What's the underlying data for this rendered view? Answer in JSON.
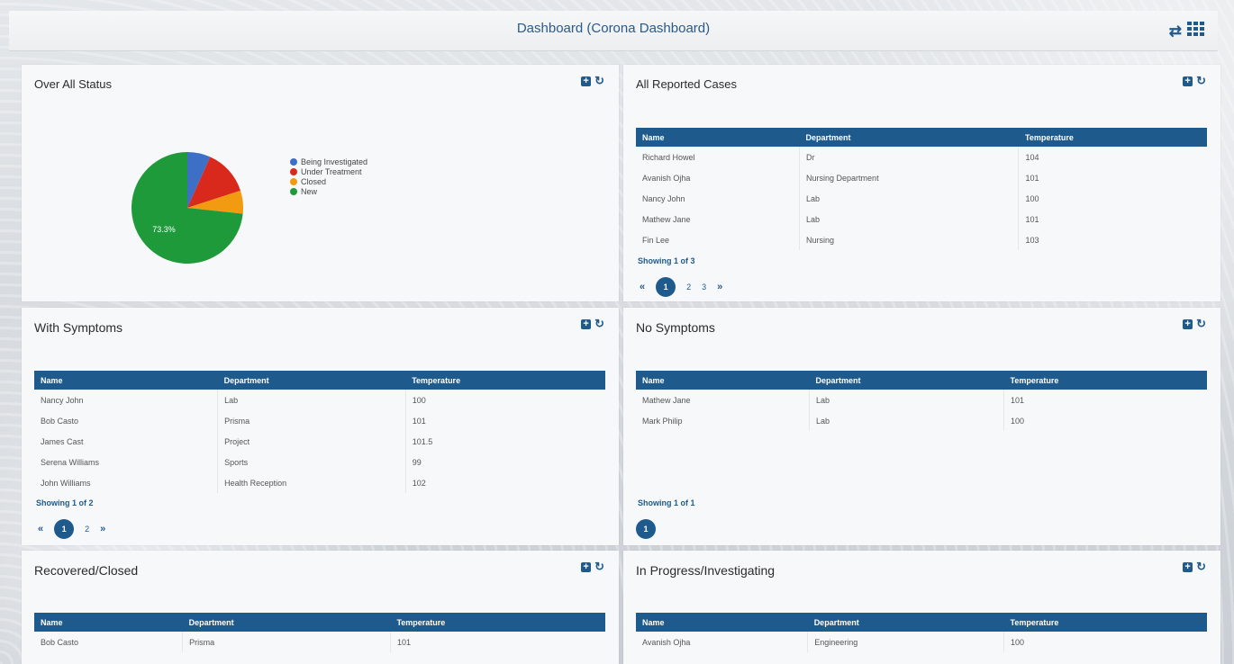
{
  "header": {
    "title": "Dashboard (Corona Dashboard)",
    "icons": [
      "swap-icon",
      "grid-icon"
    ]
  },
  "panels": {
    "overall": {
      "title": "Over All Status"
    },
    "all_reported": {
      "title": "All Reported Cases",
      "columns": [
        "Name",
        "Department",
        "Temperature"
      ],
      "rows": [
        [
          "Richard Howel",
          "Dr",
          "104"
        ],
        [
          "Avanish Ojha",
          "Nursing Department",
          "101"
        ],
        [
          "Nancy John",
          "Lab",
          "100"
        ],
        [
          "Mathew Jane",
          "Lab",
          "101"
        ],
        [
          "Fin Lee",
          "Nursing",
          "103"
        ]
      ],
      "showing": "Showing 1 of 3",
      "pages": [
        "1",
        "2",
        "3"
      ],
      "prev": "«",
      "next": "»"
    },
    "with_symptoms": {
      "title": "With Symptoms",
      "columns": [
        "Name",
        "Department",
        "Temperature"
      ],
      "rows": [
        [
          "Nancy John",
          "Lab",
          "100"
        ],
        [
          "Bob Casto",
          "Prisma",
          "101"
        ],
        [
          "James Cast",
          "Project",
          "101.5"
        ],
        [
          "Serena Williams",
          "Sports",
          "99"
        ],
        [
          "John Williams",
          "Health Reception",
          "102"
        ]
      ],
      "showing": "Showing 1 of 2",
      "pages": [
        "1",
        "2"
      ],
      "prev": "«",
      "next": "»"
    },
    "no_symptoms": {
      "title": "No Symptoms",
      "columns": [
        "Name",
        "Department",
        "Temperature"
      ],
      "rows": [
        [
          "Mathew Jane",
          "Lab",
          "101"
        ],
        [
          "Mark Philip",
          "Lab",
          "100"
        ]
      ],
      "showing": "Showing 1 of 1",
      "pages": [
        "1"
      ]
    },
    "recovered": {
      "title": "Recovered/Closed",
      "columns": [
        "Name",
        "Department",
        "Temperature"
      ],
      "rows": [
        [
          "Bob Casto",
          "Prisma",
          "101"
        ]
      ]
    },
    "in_progress": {
      "title": "In Progress/Investigating",
      "columns": [
        "Name",
        "Department",
        "Temperature"
      ],
      "rows": [
        [
          "Avanish Ojha",
          "Engineering",
          "100"
        ]
      ]
    }
  },
  "chart_data": {
    "type": "pie",
    "categories": [
      "Being Investigated",
      "Under Treatment",
      "Closed",
      "New"
    ],
    "values": [
      6.7,
      13.3,
      6.7,
      73.3
    ],
    "colors": [
      "#3e6fc6",
      "#d9291c",
      "#f29a10",
      "#1f9a3a"
    ],
    "data_labels": [
      "",
      "",
      "",
      "73.3%"
    ],
    "legend_position": "right"
  },
  "colors": {
    "accent": "#1f5a8c"
  }
}
